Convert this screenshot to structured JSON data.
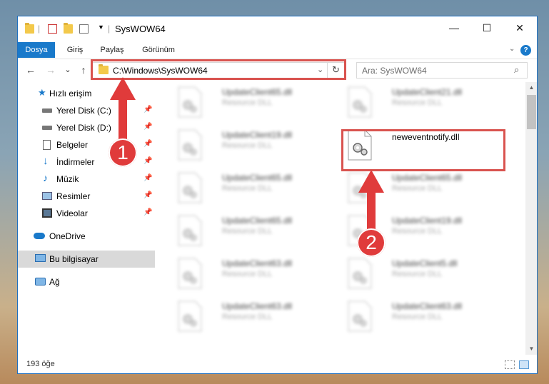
{
  "window": {
    "title": "SysWOW64",
    "controls": {
      "minimize": "—",
      "maximize": "☐",
      "close": "✕"
    }
  },
  "ribbon": {
    "tabs": [
      "Dosya",
      "Giriş",
      "Paylaş",
      "Görünüm"
    ],
    "help": "?"
  },
  "navigation": {
    "back": "←",
    "forward": "→",
    "recent": "⌄",
    "up": "↑",
    "address": "C:\\Windows\\SysWOW64",
    "search_placeholder": "Ara: SysWOW64"
  },
  "sidebar": {
    "items": [
      {
        "label": "Hızlı erişim",
        "icon": "star-icon",
        "pinned": false
      },
      {
        "label": "Yerel Disk (C:)",
        "icon": "drive-icon",
        "pinned": true
      },
      {
        "label": "Yerel Disk (D:)",
        "icon": "drive-icon",
        "pinned": true
      },
      {
        "label": "Belgeler",
        "icon": "documents-icon",
        "pinned": true
      },
      {
        "label": "İndirmeler",
        "icon": "download-icon",
        "pinned": true
      },
      {
        "label": "Müzik",
        "icon": "music-icon",
        "pinned": true
      },
      {
        "label": "Resimler",
        "icon": "pictures-icon",
        "pinned": true
      },
      {
        "label": "Videolar",
        "icon": "videos-icon",
        "pinned": true
      },
      {
        "label": "OneDrive",
        "icon": "cloud-icon",
        "pinned": false
      },
      {
        "label": "Bu bilgisayar",
        "icon": "computer-icon",
        "pinned": false,
        "selected": true
      },
      {
        "label": "Ağ",
        "icon": "network-icon",
        "pinned": false
      }
    ]
  },
  "files": {
    "highlighted": {
      "name": "neweventnotify.dll",
      "description": ""
    },
    "left_column": [
      {
        "name": "UpdateClient65.dll",
        "description": "Resource DLL"
      },
      {
        "name": "UpdateClient19.dll",
        "description": "Resource DLL"
      },
      {
        "name": "UpdateClient65.dll",
        "description": "Resource DLL"
      },
      {
        "name": "UpdateClient65.dll",
        "description": "Resource DLL"
      },
      {
        "name": "UpdateClient63.dll",
        "description": "Resource DLL"
      },
      {
        "name": "UpdateClient63.dll",
        "description": "Resource DLL"
      }
    ],
    "right_column": [
      {
        "name": "UpdateClient21.dll",
        "description": "Resource DLL"
      },
      {
        "name": "UpdateClient65.dll",
        "description": "Resource DLL"
      },
      {
        "name": "UpdateClient19.dll",
        "description": "Resource DLL"
      },
      {
        "name": "UpdateClient5.dll",
        "description": "Resource DLL"
      },
      {
        "name": "UpdateClient63.dll",
        "description": "Resource DLL"
      }
    ]
  },
  "status": {
    "item_count": "193 öğe"
  },
  "annotations": {
    "step1": "1",
    "step2": "2"
  },
  "colors": {
    "accent": "#1979ca",
    "annotation": "#e03b3b",
    "selection": "#d9d9d9"
  }
}
